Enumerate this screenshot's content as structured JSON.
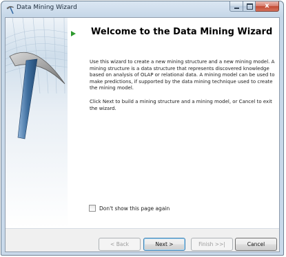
{
  "window": {
    "title": "Data Mining Wizard"
  },
  "page": {
    "heading": "Welcome to the Data Mining Wizard",
    "paragraph_1": "Use this wizard to create a new mining structure and a new mining model. A mining structure is a data structure that represents discovered knowledge based on analysis of OLAP or relational data.  A mining model can be used to make predictions, if supported by the data mining technique used to create the mining model.",
    "paragraph_2": "Click Next to build a mining structure and a mining model, or Cancel to exit the wizard.",
    "checkbox_label": "Don't show this page again",
    "checkbox_checked": false
  },
  "buttons": {
    "back": "< Back",
    "next": "Next >",
    "finish": "Finish >>|",
    "cancel": "Cancel"
  },
  "caption_buttons": {
    "close_glyph": "x"
  },
  "icons": {
    "app": "pickaxe-icon",
    "arrow": "green-arrow-icon"
  },
  "colors": {
    "accent_arrow": "#2e9a2e",
    "banner_blue": "#6b8fb4"
  }
}
